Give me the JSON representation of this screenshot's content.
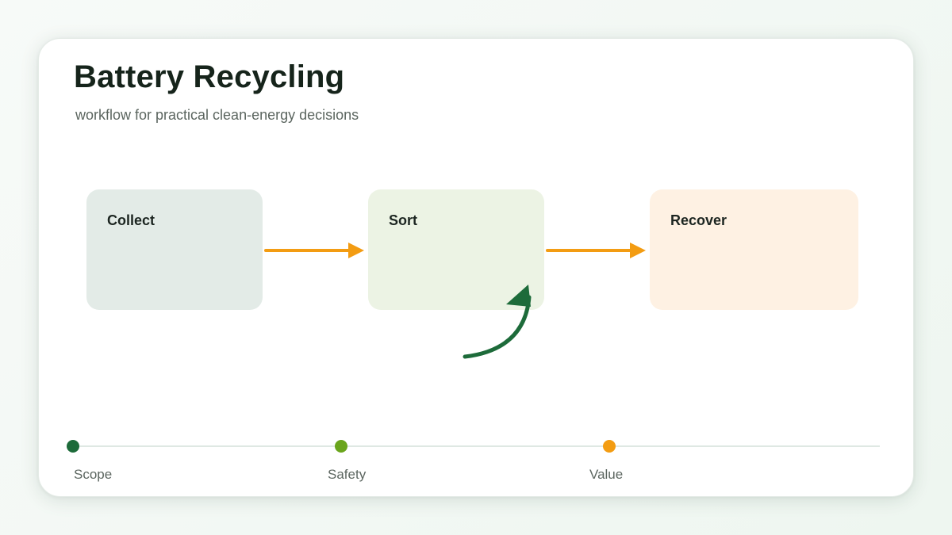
{
  "header": {
    "title": "Battery Recycling",
    "subtitle": "workflow for practical clean-energy decisions"
  },
  "steps": [
    {
      "label": "Collect"
    },
    {
      "label": "Sort"
    },
    {
      "label": "Recover"
    }
  ],
  "milestones": [
    {
      "label": "Scope",
      "color": "#1d6b3a"
    },
    {
      "label": "Safety",
      "color": "#6aa51c"
    },
    {
      "label": "Value",
      "color": "#f39c12"
    }
  ],
  "colors": {
    "flow_arrow": "#f39c12",
    "loop_arrow": "#1d6b3a"
  }
}
